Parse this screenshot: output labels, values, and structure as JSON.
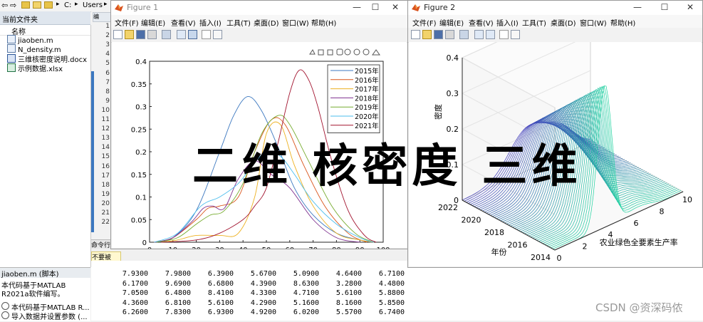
{
  "desktop": {
    "path_segments": [
      "C:",
      "Users"
    ],
    "current_folder_label": "当前文件夹",
    "files_column_header": "名称",
    "files": [
      "jiaoben.m",
      "N_density.m",
      "三维核密度说明.docx",
      "示例数据.xlsx"
    ],
    "editor_tab_label": "编",
    "editor_line_numbers": [
      "1",
      "2",
      "3",
      "4",
      "5",
      "6",
      "7",
      "8",
      "9",
      "10",
      "11",
      "12",
      "13",
      "14",
      "15",
      "16",
      "17",
      "18",
      "19",
      "20",
      "21",
      "22"
    ],
    "command_window_label": "命令行",
    "warning_label": "不要被",
    "details_title": "jiaoben.m (脚本)",
    "details_lines": [
      "本代码基于MATLAB",
      "R2021a软件编写。"
    ],
    "details_items": [
      "本代码基于MATLAB R...",
      "导入数据并设置参数 (..."
    ],
    "command_rows": [
      [
        "7.9300",
        "7.9800",
        "6.3900",
        "5.6700",
        "5.0900",
        "4.6400",
        "6.7100"
      ],
      [
        "6.1700",
        "9.6900",
        "6.6800",
        "4.3900",
        "8.6300",
        "3.2800",
        "4.4800"
      ],
      [
        "7.0500",
        "6.4800",
        "8.4100",
        "4.3300",
        "4.7100",
        "5.6100",
        "5.8800"
      ],
      [
        "4.3600",
        "6.8100",
        "5.6100",
        "4.2900",
        "5.1600",
        "8.1600",
        "5.8500"
      ],
      [
        "6.2600",
        "7.8300",
        "6.9300",
        "4.9200",
        "6.0200",
        "5.5700",
        "6.7400"
      ]
    ]
  },
  "figure1": {
    "title": "Figure 1",
    "menu": [
      "文件(F)",
      "编辑(E)",
      "查看(V)",
      "插入(I)",
      "工具(T)",
      "桌面(D)",
      "窗口(W)",
      "帮助(H)"
    ],
    "window_buttons": [
      "—",
      "☐",
      "✕"
    ]
  },
  "figure2": {
    "title": "Figure 2",
    "menu": [
      "文件(F)",
      "编辑(E)",
      "查看(V)",
      "插入(I)",
      "工具(T)",
      "桌面(D)",
      "窗口(W)",
      "帮助(H)"
    ],
    "window_buttons": [
      "—",
      "☐",
      "✕"
    ]
  },
  "overlay_text": "二维 核密度 三维",
  "watermark": "CSDN @资深码侬",
  "chart_data": [
    {
      "type": "line",
      "title": "",
      "xlabel": "",
      "ylabel": "",
      "xlim": [
        0,
        100
      ],
      "ylim": [
        0,
        0.4
      ],
      "xticks": [
        "0",
        "10",
        "20",
        "30",
        "40",
        "50",
        "60",
        "70",
        "80",
        "90",
        "100"
      ],
      "yticks": [
        "0",
        "0.05",
        "0.1",
        "0.15",
        "0.2",
        "0.25",
        "0.3",
        "0.35",
        "0.4"
      ],
      "legend_position": "top-right",
      "grid": false,
      "series": [
        {
          "name": "2015年",
          "color": "#3c78c0",
          "x": [
            2,
            10,
            20,
            30,
            36,
            42,
            48,
            55,
            62,
            70,
            80,
            90,
            95
          ],
          "y": [
            0,
            0.01,
            0.07,
            0.2,
            0.28,
            0.322,
            0.29,
            0.21,
            0.12,
            0.06,
            0.02,
            0.005,
            0
          ]
        },
        {
          "name": "2016年",
          "color": "#d95319",
          "x": [
            2,
            10,
            20,
            25,
            30,
            38,
            45,
            52,
            58,
            66,
            75,
            85,
            93
          ],
          "y": [
            0,
            0.01,
            0.05,
            0.075,
            0.08,
            0.1,
            0.2,
            0.27,
            0.26,
            0.17,
            0.08,
            0.02,
            0
          ]
        },
        {
          "name": "2017年",
          "color": "#edb120",
          "x": [
            5,
            12,
            20,
            30,
            38,
            45,
            50,
            56,
            62,
            70,
            80,
            90,
            96
          ],
          "y": [
            0,
            0.005,
            0.015,
            0.015,
            0.02,
            0.1,
            0.24,
            0.26,
            0.17,
            0.08,
            0.02,
            0.005,
            0
          ]
        },
        {
          "name": "2018年",
          "color": "#7e2f8e",
          "x": [
            2,
            10,
            18,
            23,
            27,
            32,
            38,
            45,
            52,
            60,
            70,
            80,
            90
          ],
          "y": [
            0,
            0.01,
            0.045,
            0.075,
            0.08,
            0.075,
            0.14,
            0.18,
            0.15,
            0.12,
            0.05,
            0.01,
            0
          ]
        },
        {
          "name": "2019年",
          "color": "#77ac30",
          "x": [
            3,
            12,
            20,
            26,
            32,
            40,
            48,
            55,
            60,
            68,
            78,
            88,
            96
          ],
          "y": [
            0,
            0.01,
            0.04,
            0.06,
            0.07,
            0.13,
            0.24,
            0.28,
            0.26,
            0.18,
            0.08,
            0.02,
            0
          ]
        },
        {
          "name": "2020年",
          "color": "#4dbeee",
          "x": [
            2,
            12,
            22,
            30,
            38,
            44,
            50,
            56,
            62,
            70,
            80,
            90,
            96
          ],
          "y": [
            0,
            0.02,
            0.08,
            0.1,
            0.13,
            0.17,
            0.2,
            0.19,
            0.15,
            0.09,
            0.04,
            0.01,
            0
          ]
        },
        {
          "name": "2021年",
          "color": "#a2142f",
          "x": [
            5,
            20,
            30,
            40,
            45,
            50,
            55,
            60,
            64,
            68,
            72,
            78,
            85,
            92,
            97
          ],
          "y": [
            0,
            0.005,
            0.02,
            0.05,
            0.08,
            0.12,
            0.22,
            0.33,
            0.38,
            0.36,
            0.3,
            0.18,
            0.07,
            0.015,
            0
          ]
        }
      ]
    },
    {
      "type": "surface",
      "title": "",
      "xlabel": "农业绿色全要素生产率",
      "ylabel": "年份",
      "zlabel": "密度",
      "xlim": [
        0,
        10
      ],
      "ylim": [
        2014,
        2022
      ],
      "zlim": [
        0,
        0.4
      ],
      "xticks": [
        "0",
        "2",
        "4",
        "6",
        "8",
        "10"
      ],
      "yticks": [
        "2014",
        "2016",
        "2018",
        "2020",
        "2022"
      ],
      "zticks": [
        "0",
        "0.1",
        "0.2",
        "0.3",
        "0.4"
      ],
      "peak": {
        "x": 4.2,
        "year": 2015,
        "density": 0.4
      }
    }
  ]
}
